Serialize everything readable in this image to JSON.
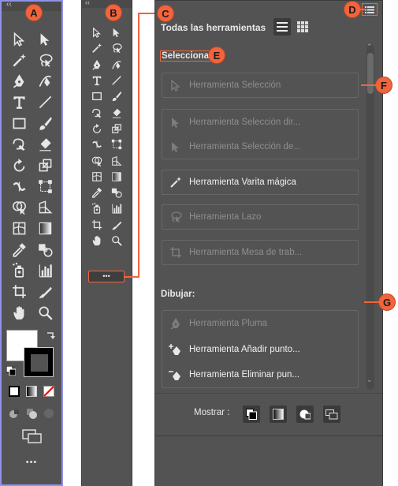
{
  "callouts": {
    "a": "A",
    "b": "B",
    "c": "C",
    "d": "D",
    "e": "E",
    "f": "F",
    "g": "G"
  },
  "panel_a": {
    "collapse_glyph": "‹‹",
    "more_glyph": "•••"
  },
  "panel_b": {
    "collapse_glyph": "‹‹",
    "more_glyph": "•••"
  },
  "panel_c": {
    "title": "Todas las herramientas",
    "section_select": "Selecciona",
    "section_draw": "Dibujar:",
    "select_tools": [
      {
        "label": "Herramienta Selección",
        "state": "disabled"
      },
      {
        "label": "Herramienta Selección dir...",
        "state": "disabled"
      },
      {
        "label": "Herramienta Selección de...",
        "state": "disabled"
      },
      {
        "label": "Herramienta Varita mágica",
        "state": "enabled"
      },
      {
        "label": "Herramienta Lazo",
        "state": "disabled"
      },
      {
        "label": "Herramienta Mesa de trab...",
        "state": "disabled"
      }
    ],
    "draw_tools": [
      {
        "label": "Herramienta Pluma",
        "state": "disabled"
      },
      {
        "label": "Herramienta Añadir punto...",
        "state": "enabled"
      },
      {
        "label": "Herramienta Eliminar pun...",
        "state": "enabled"
      }
    ],
    "show_label": "Mostrar :"
  },
  "colors": {
    "callout": "#f2643c",
    "panel": "#535353",
    "outline_a": "#8f93e8"
  }
}
